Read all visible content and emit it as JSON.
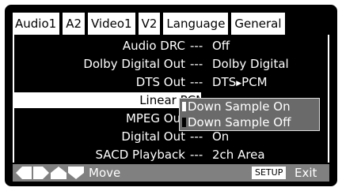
{
  "tabs": [
    "Audio1",
    "A2",
    "Video1",
    "V2",
    "Language",
    "General"
  ],
  "rows": [
    {
      "label": "Audio DRC",
      "value": "Off"
    },
    {
      "label": "Dolby Digital Out",
      "value": "Dolby Digital"
    },
    {
      "label": "DTS Out",
      "value_pre": "DTS",
      "value_post": "PCM"
    },
    {
      "label": "Linear PCM Out",
      "value": ""
    },
    {
      "label": "MPEG Out",
      "value": ""
    },
    {
      "label": "Digital Out",
      "value": "On"
    },
    {
      "label": "SACD Playback",
      "value": "2ch Area"
    }
  ],
  "separator": "---",
  "popup": {
    "options": [
      "Down Sample On",
      "Down Sample Off"
    ],
    "highlighted_index": 1
  },
  "bottom": {
    "nav_icons": [
      "left-arrow-icon",
      "right-arrow-icon",
      "up-arrow-icon",
      "down-arrow-icon"
    ],
    "move_label": "Move",
    "setup_label": "SETUP",
    "exit_label": "Exit"
  },
  "colors": {
    "background": "#000000",
    "highlight": "#ffffff",
    "popup": "#6a6a6a",
    "bar": "#808080"
  }
}
